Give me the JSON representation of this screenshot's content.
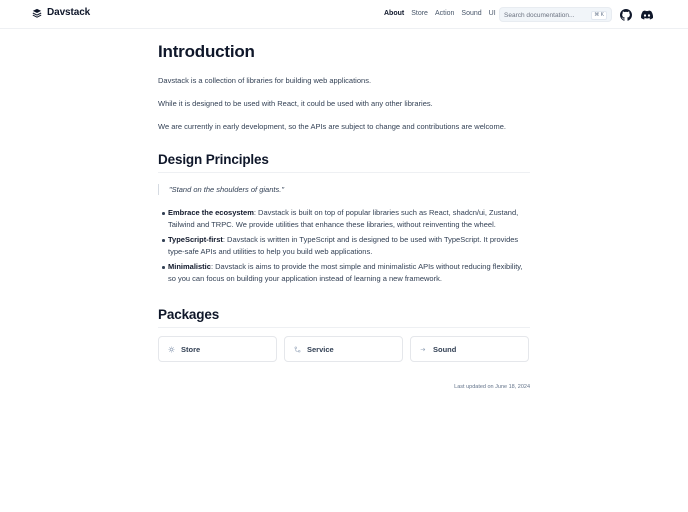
{
  "brand": {
    "name": "Davstack"
  },
  "nav": {
    "items": [
      {
        "label": "About",
        "active": true
      },
      {
        "label": "Store",
        "active": false
      },
      {
        "label": "Action",
        "active": false
      },
      {
        "label": "Sound",
        "active": false
      },
      {
        "label": "UI",
        "active": false
      }
    ]
  },
  "search": {
    "placeholder": "Search documentation...",
    "shortcut": "⌘ K"
  },
  "header_icons": [
    "github-icon",
    "discord-icon"
  ],
  "page": {
    "title": "Introduction",
    "paragraphs": [
      "Davstack is a collection of libraries for building web applications.",
      "While it is designed to be used with React, it could be used with any other libraries.",
      "We are currently in early development, so the APIs are subject to change and contributions are welcome."
    ],
    "principles_heading": "Design Principles",
    "quote": "\"Stand on the shoulders of giants.\"",
    "principles": [
      {
        "term": "Embrace the ecosystem",
        "text": ": Davstack is built on top of popular libraries such as React, shadcn/ui, Zustand, Tailwind and TRPC. We provide utilities that enhance these libraries, without reinventing the wheel."
      },
      {
        "term": "TypeScript-first",
        "text": ": Davstack is written in TypeScript and is designed to be used with TypeScript. It provides type-safe APIs and utilities to help you build web applications."
      },
      {
        "term": "Minimalistic",
        "text": ": Davstack is aims to provide the most simple and minimalistic APIs without reducing flexibility, so you can focus on building your application instead of learning a new framework."
      }
    ],
    "packages_heading": "Packages",
    "packages": [
      {
        "label": "Store",
        "icon": "store-icon"
      },
      {
        "label": "Service",
        "icon": "service-icon"
      },
      {
        "label": "Sound",
        "icon": "sound-icon"
      }
    ],
    "last_updated": "Last updated on June 18, 2024"
  },
  "colors": {
    "text": "#0f172a",
    "muted": "#64748b",
    "border": "#e5e7eb"
  }
}
